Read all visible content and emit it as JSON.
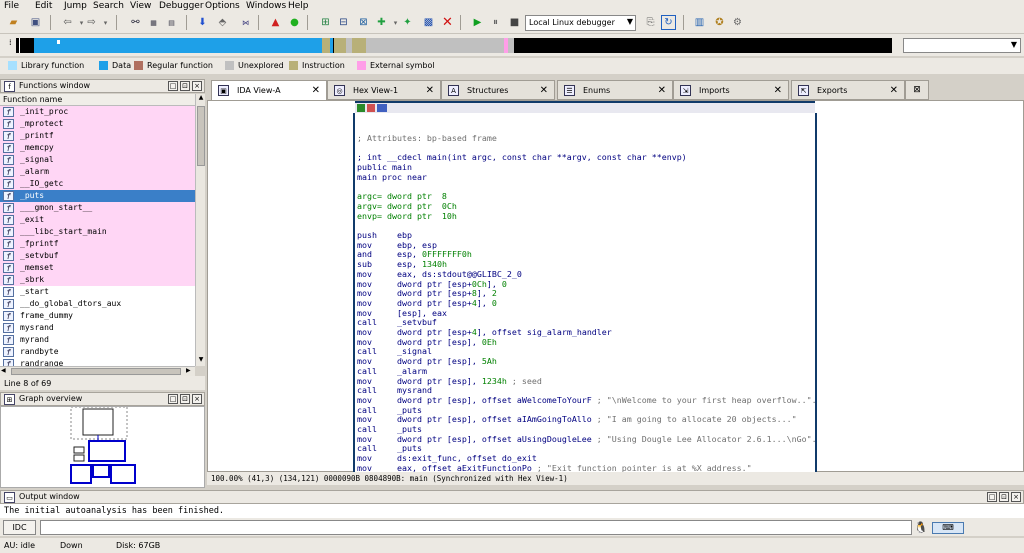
{
  "menu": [
    "File",
    "Edit",
    "Jump",
    "Search",
    "View",
    "Debugger",
    "Options",
    "Windows",
    "Help"
  ],
  "toolbar": {
    "debugger_select": "Local Linux debugger"
  },
  "legend": [
    {
      "label": "Library function",
      "color": "#a6e0ff"
    },
    {
      "label": "Data",
      "color": "#1ea0e8"
    },
    {
      "label": "Regular function",
      "color": "#b07060"
    },
    {
      "label": "Unexplored",
      "color": "#c0c0c0"
    },
    {
      "label": "Instruction",
      "color": "#b8b078"
    },
    {
      "label": "External symbol",
      "color": "#ff9ee8"
    }
  ],
  "functions_window": {
    "title": "Functions window",
    "column": "Function name",
    "items": [
      "_init_proc",
      "_mprotect",
      "_printf",
      "_memcpy",
      "_signal",
      "_alarm",
      "__IO_getc",
      "_puts",
      "___gmon_start__",
      "_exit",
      "___libc_start_main",
      "_fprintf",
      "_setvbuf",
      "_memset",
      "_sbrk",
      "_start",
      "__do_global_dtors_aux",
      "frame_dummy",
      "mysrand",
      "myrand",
      "randbyte",
      "randrange"
    ],
    "selected_index": 7,
    "line_count": "Line 8 of 69"
  },
  "graph_overview": {
    "title": "Graph overview"
  },
  "tabs": [
    "IDA View-A",
    "Hex View-1",
    "Structures",
    "Enums",
    "Imports",
    "Exports"
  ],
  "code": [
    "; Attributes: bp-based frame",
    "",
    "; int __cdecl main(int argc, const char **argv, const char **envp)",
    "public main",
    "main proc near",
    "",
    "argc= dword ptr  8",
    "argv= dword ptr  0Ch",
    "envp= dword ptr  10h",
    "",
    "push    ebp",
    "mov     ebp, esp",
    "and     esp, 0FFFFFFF0h",
    "sub     esp, 1340h",
    "mov     eax, ds:stdout@@GLIBC_2_0",
    "mov     dword ptr [esp+0Ch], 0",
    "mov     dword ptr [esp+8], 2",
    "mov     dword ptr [esp+4], 0",
    "mov     [esp], eax",
    "call    _setvbuf",
    "mov     dword ptr [esp+4], offset sig_alarm_handler",
    "mov     dword ptr [esp], 0Eh",
    "call    _signal",
    "mov     dword ptr [esp], 5Ah",
    "call    _alarm",
    "mov     dword ptr [esp], 1234h ; seed",
    "call    mysrand",
    "mov     dword ptr [esp], offset aWelcomeToYourF ; \"\\nWelcome to your first heap overflow..\"...",
    "call    _puts",
    "mov     dword ptr [esp], offset aIAmGoingToAllo ; \"I am going to allocate 20 objects...\"",
    "call    _puts",
    "mov     dword ptr [esp], offset aUsingDougleLee ; \"Using Dougle Lee Allocator 2.6.1...\\nGo\"...",
    "call    _puts",
    "mov     ds:exit_func, offset do_exit",
    "mov     eax, offset aExitFunctionPo ; \"Exit function pointer is at %X address.\""
  ],
  "status_line": "100.00% (41,3) (134,121) 0000090B 0804890B: main (Synchronized with Hex View-1)",
  "output_window": {
    "title": "Output window",
    "text": "The initial autoanalysis has been finished."
  },
  "idc_button": "IDC",
  "bottom_status": {
    "au": "AU:  idle",
    "down": "Down",
    "disk": "Disk: 67GB"
  }
}
